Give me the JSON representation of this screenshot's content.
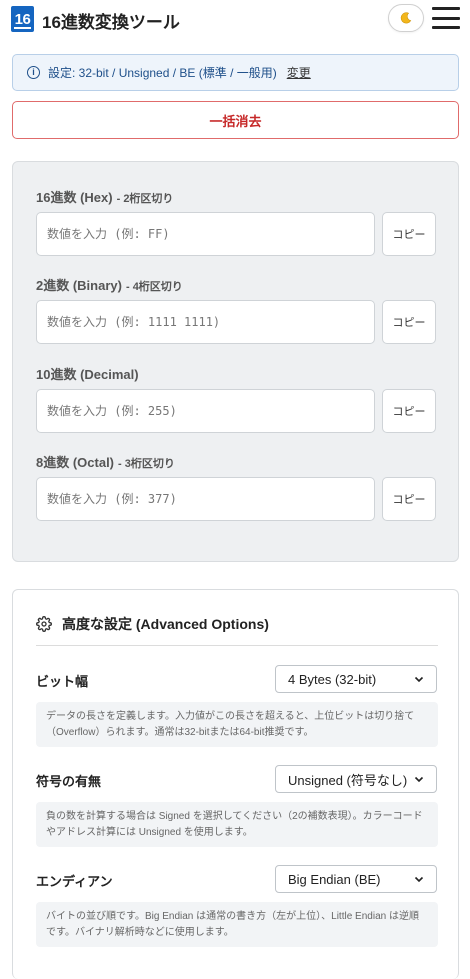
{
  "header": {
    "logo_text": "16",
    "title": "16進数変換ツール",
    "theme_icon": "moon-icon",
    "menu_icon": "hamburger-icon"
  },
  "info": {
    "text": "設定: 32-bit / Unsigned / BE (標準 / 一般用)",
    "change_link": "変更"
  },
  "clear_button": "一括消去",
  "converter": {
    "fields": [
      {
        "label": "16進数 (Hex)",
        "hint": "- 2桁区切り",
        "placeholder": "数値を入力 (例: FF)",
        "copy": "コピー"
      },
      {
        "label": "2進数 (Binary)",
        "hint": "- 4桁区切り",
        "placeholder": "数値を入力 (例: 1111 1111)",
        "copy": "コピー"
      },
      {
        "label": "10進数 (Decimal)",
        "hint": "",
        "placeholder": "数値を入力 (例: 255)",
        "copy": "コピー"
      },
      {
        "label": "8進数 (Octal)",
        "hint": "- 3桁区切り",
        "placeholder": "数値を入力 (例: 377)",
        "copy": "コピー"
      }
    ]
  },
  "advanced": {
    "title": "高度な設定 (Advanced Options)",
    "options": [
      {
        "label": "ビット幅",
        "selected": "4 Bytes (32-bit)",
        "description": "データの長さを定義します。入力値がこの長さを超えると、上位ビットは切り捨て（Overflow）られます。通常は32-bitまたは64-bit推奨です。"
      },
      {
        "label": "符号の有無",
        "selected": "Unsigned (符号なし)",
        "description": "負の数を計算する場合は Signed を選択してください（2の補数表現）。カラーコードやアドレス計算には Unsigned を使用します。"
      },
      {
        "label": "エンディアン",
        "selected": "Big Endian (BE)",
        "description": "バイトの並び順です。Big Endian は通常の書き方（左が上位）、Little Endian は逆順です。バイナリ解析時などに使用します。"
      }
    ]
  },
  "colors": {
    "brand": "#1565c0",
    "danger": "#c62828",
    "info_bg": "#eef4fb"
  }
}
